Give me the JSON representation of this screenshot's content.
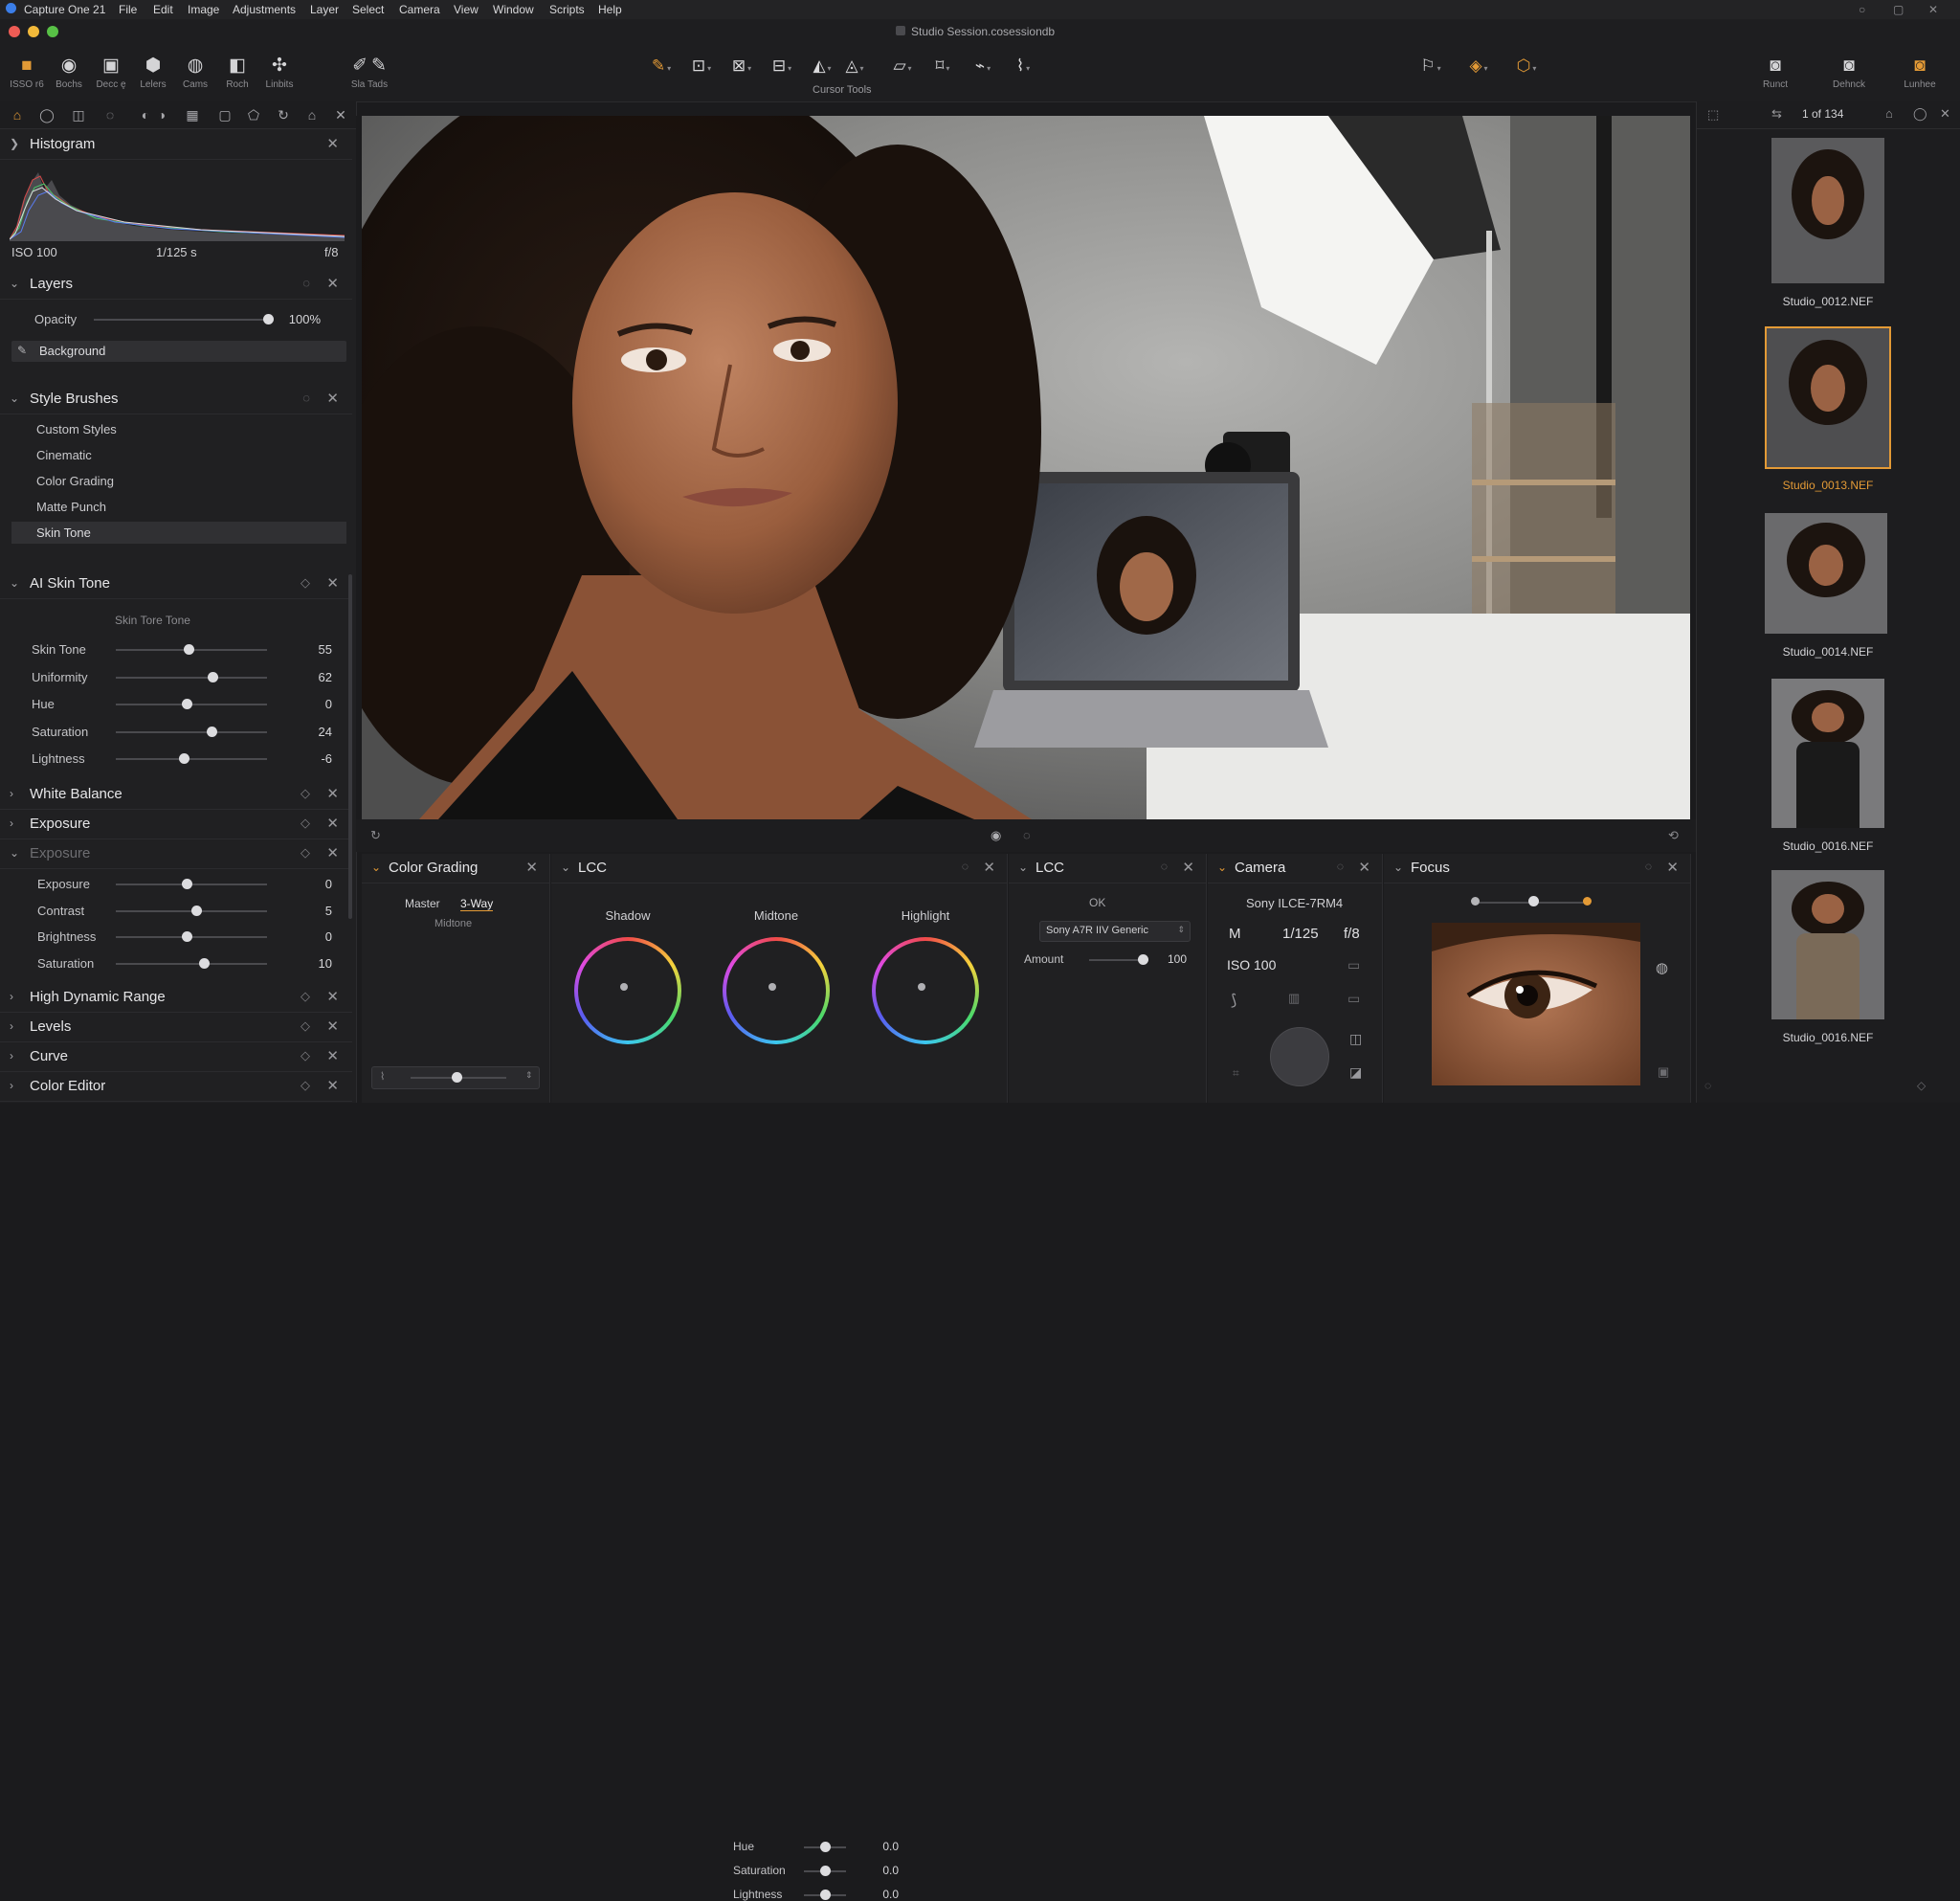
{
  "app": {
    "name": "Capture One 21",
    "document_title": "Studio Session.cosessiondb"
  },
  "menu": [
    "File",
    "Edit",
    "Image",
    "Adjustments",
    "Layer",
    "Select",
    "Camera",
    "View",
    "Window",
    "Scripts",
    "Help"
  ],
  "toolbar": {
    "left_buttons": [
      {
        "label": "ISSO r6",
        "icon": "import-icon"
      },
      {
        "label": "Bochs",
        "icon": "capture-icon"
      },
      {
        "label": "Decc ȩ",
        "icon": "library-icon"
      },
      {
        "label": "Lelers",
        "icon": "layers-icon"
      },
      {
        "label": "Cams",
        "icon": "camera-icon"
      },
      {
        "label": "Roch",
        "icon": "crop-icon"
      },
      {
        "label": "Linbits",
        "icon": "tether-icon"
      }
    ],
    "extra_button": {
      "label": "Sla Tads",
      "icons": [
        "brush-tool-icon",
        "dropper-icon"
      ]
    },
    "cursor_tools_label": "Cursor Tools",
    "cursor_tools": [
      "pan-icon",
      "loupe-icon",
      "crop-icon",
      "rotate-icon",
      "keystone-icon",
      "spot-icon",
      "mask-icon",
      "eraser-icon",
      "gradient-icon",
      "brush-icon"
    ],
    "right_buttons": [
      {
        "label": "Runct",
        "icon": "reset-icon"
      },
      {
        "label": "Dehnck",
        "icon": "process-icon"
      },
      {
        "label": "Lunhee",
        "icon": "export-icon"
      }
    ]
  },
  "histogram": {
    "title": "Histogram",
    "iso": "ISO 100",
    "shutter": "1/125 s",
    "aperture": "f/8"
  },
  "layers": {
    "title": "Layers",
    "opacity_label": "Opacity",
    "opacity_value": "100%",
    "opacity_fraction": 1.0,
    "layer_name": "Background"
  },
  "style_brushes": {
    "title": "Style Brushes",
    "items": [
      "Custom Styles",
      "Cinematic",
      "Color Grading",
      "Matte Punch",
      "Skin Tone"
    ],
    "selected_index": 4
  },
  "ai_skin_tone": {
    "title": "AI Skin Tone",
    "subtitle": "Skin Tore  Tone",
    "sliders": [
      {
        "label": "Skin Tone",
        "value": "55",
        "fraction": 0.48
      },
      {
        "label": "Uniformity",
        "value": "62",
        "fraction": 0.64
      },
      {
        "label": "Hue",
        "value": "0",
        "fraction": 0.47
      },
      {
        "label": "Saturation",
        "value": "24",
        "fraction": 0.63
      },
      {
        "label": "Lightness",
        "value": "-6",
        "fraction": 0.45
      }
    ]
  },
  "white_balance": {
    "title": "White Balance"
  },
  "exposure": {
    "title": "Exposure"
  },
  "exposure2": {
    "title": "Exposure",
    "sliders": [
      {
        "label": "Exposure",
        "value": "0",
        "fraction": 0.47
      },
      {
        "label": "Contrast",
        "value": "5",
        "fraction": 0.53
      },
      {
        "label": "Brightness",
        "value": "0",
        "fraction": 0.47
      },
      {
        "label": "Saturation",
        "value": "10",
        "fraction": 0.58
      }
    ]
  },
  "collapsed_tools": [
    "High Dynamic Range",
    "Levels",
    "Curve",
    "Color Editor"
  ],
  "viewer": {
    "subject": "studio portrait"
  },
  "color_grading": {
    "title": "Color Grading",
    "tabs": [
      "Master",
      "3-Way"
    ],
    "sub_label": "Midtone",
    "sliders": [
      {
        "label": "Hue",
        "value": "0.0",
        "fraction": 0.5
      },
      {
        "label": "Saturation",
        "value": "0.0",
        "fraction": 0.5
      },
      {
        "label": "Lightness",
        "value": "0.0",
        "fraction": 0.5
      }
    ]
  },
  "lcc_wheels": {
    "title": "LCC",
    "wheels": [
      "Shadow",
      "Midtone",
      "Highlight"
    ]
  },
  "lcc_profile": {
    "title": "LCC",
    "icon_label": "OK",
    "profile": "Sony A7R IIV Generic",
    "amount_label": "Amount",
    "amount_value": "100",
    "amount_fraction": 0.9
  },
  "camera": {
    "title": "Camera",
    "model": "Sony ILCE-7RM4",
    "mode": "M",
    "shutter": "1/125",
    "aperture": "f/8",
    "iso": "ISO 100"
  },
  "focus": {
    "title": "Focus"
  },
  "filmstrip": {
    "counter": "1 of 134",
    "items": [
      {
        "name": "Studio_0012.NEF",
        "selected": false
      },
      {
        "name": "Studio_0013.NEF",
        "selected": true
      },
      {
        "name": "Studio_0014.NEF",
        "selected": false
      },
      {
        "name": "Studio_0016.NEF",
        "selected": false
      },
      {
        "name": "Studio_0016.NEF",
        "selected": false
      }
    ]
  },
  "colors": {
    "accent": "#e39a36",
    "bg": "#1b1b1d",
    "panel": "#202022",
    "text": "#c9c9cc"
  }
}
